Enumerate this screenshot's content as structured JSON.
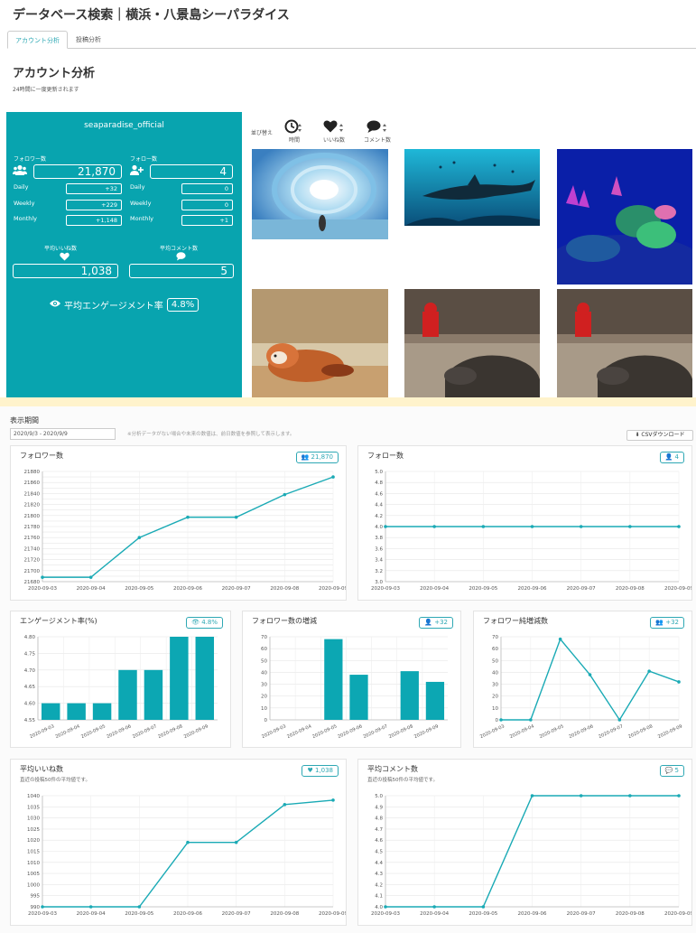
{
  "header": {
    "title": "データベース検索｜横浜・八景島シーパラダイス"
  },
  "tabs": [
    {
      "label": "アカウント分析"
    },
    {
      "label": "投稿分析"
    }
  ],
  "section": {
    "title": "アカウント分析",
    "note": "24時間に一度更新されます"
  },
  "account": {
    "name": "seaparadise_official",
    "followers_label": "フォロワー数",
    "followers": "21,870",
    "following_label": "フォロー数",
    "following": "4",
    "daily_label": "Daily",
    "weekly_label": "Weekly",
    "monthly_label": "Monthly",
    "followers_daily": "+32",
    "followers_weekly": "+229",
    "followers_monthly": "+1,148",
    "following_daily": "0",
    "following_weekly": "0",
    "following_monthly": "+1",
    "avg_likes_label": "平均いいね数",
    "avg_likes": "1,038",
    "avg_comments_label": "平均コメント数",
    "avg_comments": "5",
    "engagement_label": "平均エンゲージメント率",
    "engagement": "4.8%"
  },
  "sort": {
    "label": "並び替え",
    "options": [
      "時間",
      "いいね数",
      "コメント数"
    ]
  },
  "period": {
    "label": "表示期間",
    "value": "2020/9/3 - 2020/9/9",
    "note": "※分析データがない場合や未来の数値は、前日数値を参照して表示します。"
  },
  "csv_button": "CSVダウンロード",
  "colors": {
    "accent": "#08a4af",
    "line": "#1aaab5",
    "bar": "#0ca7b3"
  },
  "icons": {
    "followers": "users-icon",
    "following": "user-plus-icon",
    "likes": "heart-icon",
    "comments": "comment-icon",
    "engagement": "eye-icon",
    "download": "download-icon",
    "time": "clock-icon"
  },
  "chart_data": [
    {
      "type": "line",
      "title": "フォロワー数",
      "badge": "21,870",
      "x": [
        "2020-09-03",
        "2020-09-04",
        "2020-09-05",
        "2020-09-06",
        "2020-09-07",
        "2020-09-08",
        "2020-09-09"
      ],
      "values": [
        21688,
        21688,
        21760,
        21797,
        21797,
        21838,
        21870
      ],
      "ylim": [
        21680,
        21880
      ],
      "yticks": [
        21680,
        21690,
        21700,
        21710,
        21720,
        21730,
        21740,
        21750,
        21760,
        21770,
        21780,
        21790,
        21800,
        21810,
        21820,
        21830,
        21840,
        21850,
        21860,
        21870,
        21880
      ],
      "ytick_labels": [
        "21680",
        "",
        "21700",
        "",
        "21720",
        "",
        "21740",
        "",
        "21760",
        "",
        "21780",
        "",
        "21800",
        "",
        "21820",
        "",
        "21840",
        "",
        "21860",
        "",
        "21880"
      ],
      "grid": true
    },
    {
      "type": "line",
      "title": "フォロー数",
      "badge": "4",
      "x": [
        "2020-09-03",
        "2020-09-04",
        "2020-09-05",
        "2020-09-06",
        "2020-09-07",
        "2020-09-08",
        "2020-09-09"
      ],
      "values": [
        4,
        4,
        4,
        4,
        4,
        4,
        4
      ],
      "ylim": [
        3.0,
        5.0
      ],
      "yticks": [
        3.0,
        3.2,
        3.4,
        3.6,
        3.8,
        4.0,
        4.2,
        4.4,
        4.6,
        4.8,
        5.0
      ],
      "ytick_labels": [
        "3.0",
        "3.2",
        "3.4",
        "3.6",
        "3.8",
        "4.0",
        "4.2",
        "4.4",
        "4.6",
        "4.8",
        "5.0"
      ],
      "grid": true
    },
    {
      "type": "bar",
      "title": "エンゲージメント率(%)",
      "badge": "4.8%",
      "x": [
        "2020-09-03",
        "2020-09-04",
        "2020-09-05",
        "2020-09-06",
        "2020-09-07",
        "2020-09-08",
        "2020-09-09"
      ],
      "values": [
        4.6,
        4.6,
        4.6,
        4.7,
        4.7,
        4.8,
        4.8
      ],
      "ylim": [
        4.55,
        4.8
      ],
      "yticks": [
        4.55,
        4.6,
        4.65,
        4.7,
        4.75,
        4.8
      ],
      "ytick_labels": [
        "4.55",
        "4.60",
        "4.65",
        "4.70",
        "4.75",
        "4.80"
      ],
      "grid": true
    },
    {
      "type": "bar",
      "title": "フォロワー数の増減",
      "badge": "+32",
      "x": [
        "2020-09-03",
        "2020-09-04",
        "2020-09-05",
        "2020-09-06",
        "2020-09-07",
        "2020-09-08",
        "2020-09-09"
      ],
      "values": [
        0,
        0,
        68,
        38,
        0,
        41,
        32
      ],
      "ylim": [
        0,
        70
      ],
      "yticks": [
        0,
        10,
        20,
        30,
        40,
        50,
        60,
        70
      ],
      "ytick_labels": [
        "0",
        "10",
        "20",
        "30",
        "40",
        "50",
        "60",
        "70"
      ],
      "grid": true
    },
    {
      "type": "line",
      "title": "フォロワー純増減数",
      "badge": "+32",
      "x": [
        "2020-09-03",
        "2020-09-04",
        "2020-09-05",
        "2020-09-06",
        "2020-09-07",
        "2020-09-08",
        "2020-09-09"
      ],
      "values": [
        0,
        0,
        68,
        38,
        0,
        41,
        32
      ],
      "ylim": [
        0,
        70
      ],
      "yticks": [
        0,
        10,
        20,
        30,
        40,
        50,
        60,
        70
      ],
      "ytick_labels": [
        "0",
        "10",
        "20",
        "30",
        "40",
        "50",
        "60",
        "70"
      ],
      "grid": true
    },
    {
      "type": "line",
      "title": "平均いいね数",
      "subtitle": "直近の投稿50件の平均値です。",
      "badge": "1,038",
      "x": [
        "2020-09-03",
        "2020-09-04",
        "2020-09-05",
        "2020-09-06",
        "2020-09-07",
        "2020-09-08",
        "2020-09-09"
      ],
      "values": [
        990,
        990,
        990,
        1019,
        1019,
        1036,
        1038
      ],
      "ylim": [
        990,
        1040
      ],
      "yticks": [
        990,
        995,
        1000,
        1005,
        1010,
        1015,
        1020,
        1025,
        1030,
        1035,
        1040
      ],
      "ytick_labels": [
        "990",
        "995",
        "1000",
        "1005",
        "1010",
        "1015",
        "1020",
        "1025",
        "1030",
        "1035",
        "1040"
      ],
      "grid": true
    },
    {
      "type": "line",
      "title": "平均コメント数",
      "subtitle": "直近の投稿50件の平均値です。",
      "badge": "5",
      "x": [
        "2020-09-03",
        "2020-09-04",
        "2020-09-05",
        "2020-09-06",
        "2020-09-07",
        "2020-09-08",
        "2020-09-09"
      ],
      "values": [
        4,
        4,
        4,
        5,
        5,
        5,
        5
      ],
      "ylim": [
        4.0,
        5.0
      ],
      "yticks": [
        4.0,
        4.1,
        4.2,
        4.3,
        4.4,
        4.5,
        4.6,
        4.7,
        4.8,
        4.9,
        5.0
      ],
      "ytick_labels": [
        "4.0",
        "4.1",
        "4.2",
        "4.3",
        "4.4",
        "4.5",
        "4.6",
        "4.7",
        "4.8",
        "4.9",
        "5.0"
      ],
      "grid": true
    }
  ]
}
